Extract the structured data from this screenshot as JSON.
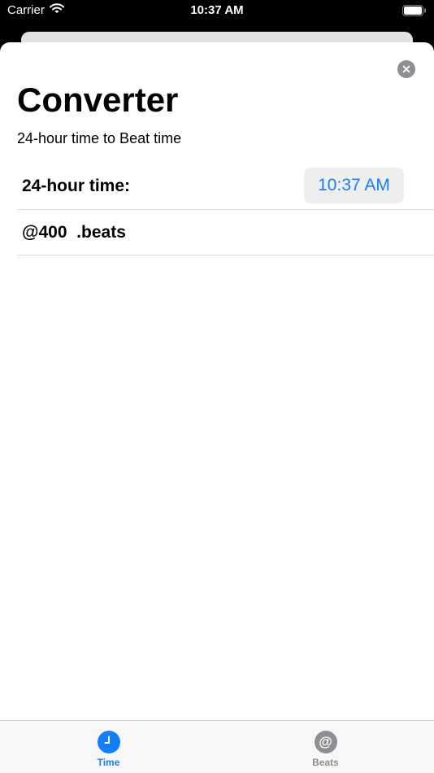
{
  "status_bar": {
    "carrier": "Carrier",
    "time": "10:37 AM"
  },
  "sheet": {
    "title": "Converter",
    "subtitle": "24-hour time to Beat time",
    "time_row": {
      "label": "24-hour time:",
      "value": "10:37 AM"
    },
    "beats_row": {
      "value": "@400  .beats"
    }
  },
  "tab_bar": {
    "tabs": [
      {
        "label": "Time",
        "icon": "clock-icon",
        "active": true
      },
      {
        "label": "Beats",
        "icon": "at-sign-icon",
        "active": false
      }
    ],
    "beats_icon_glyph": "@"
  },
  "colors": {
    "accent": "#147efb",
    "inactive": "#8e8e93",
    "separator": "#dcdcdf",
    "picker_bg": "#eeeeef"
  }
}
